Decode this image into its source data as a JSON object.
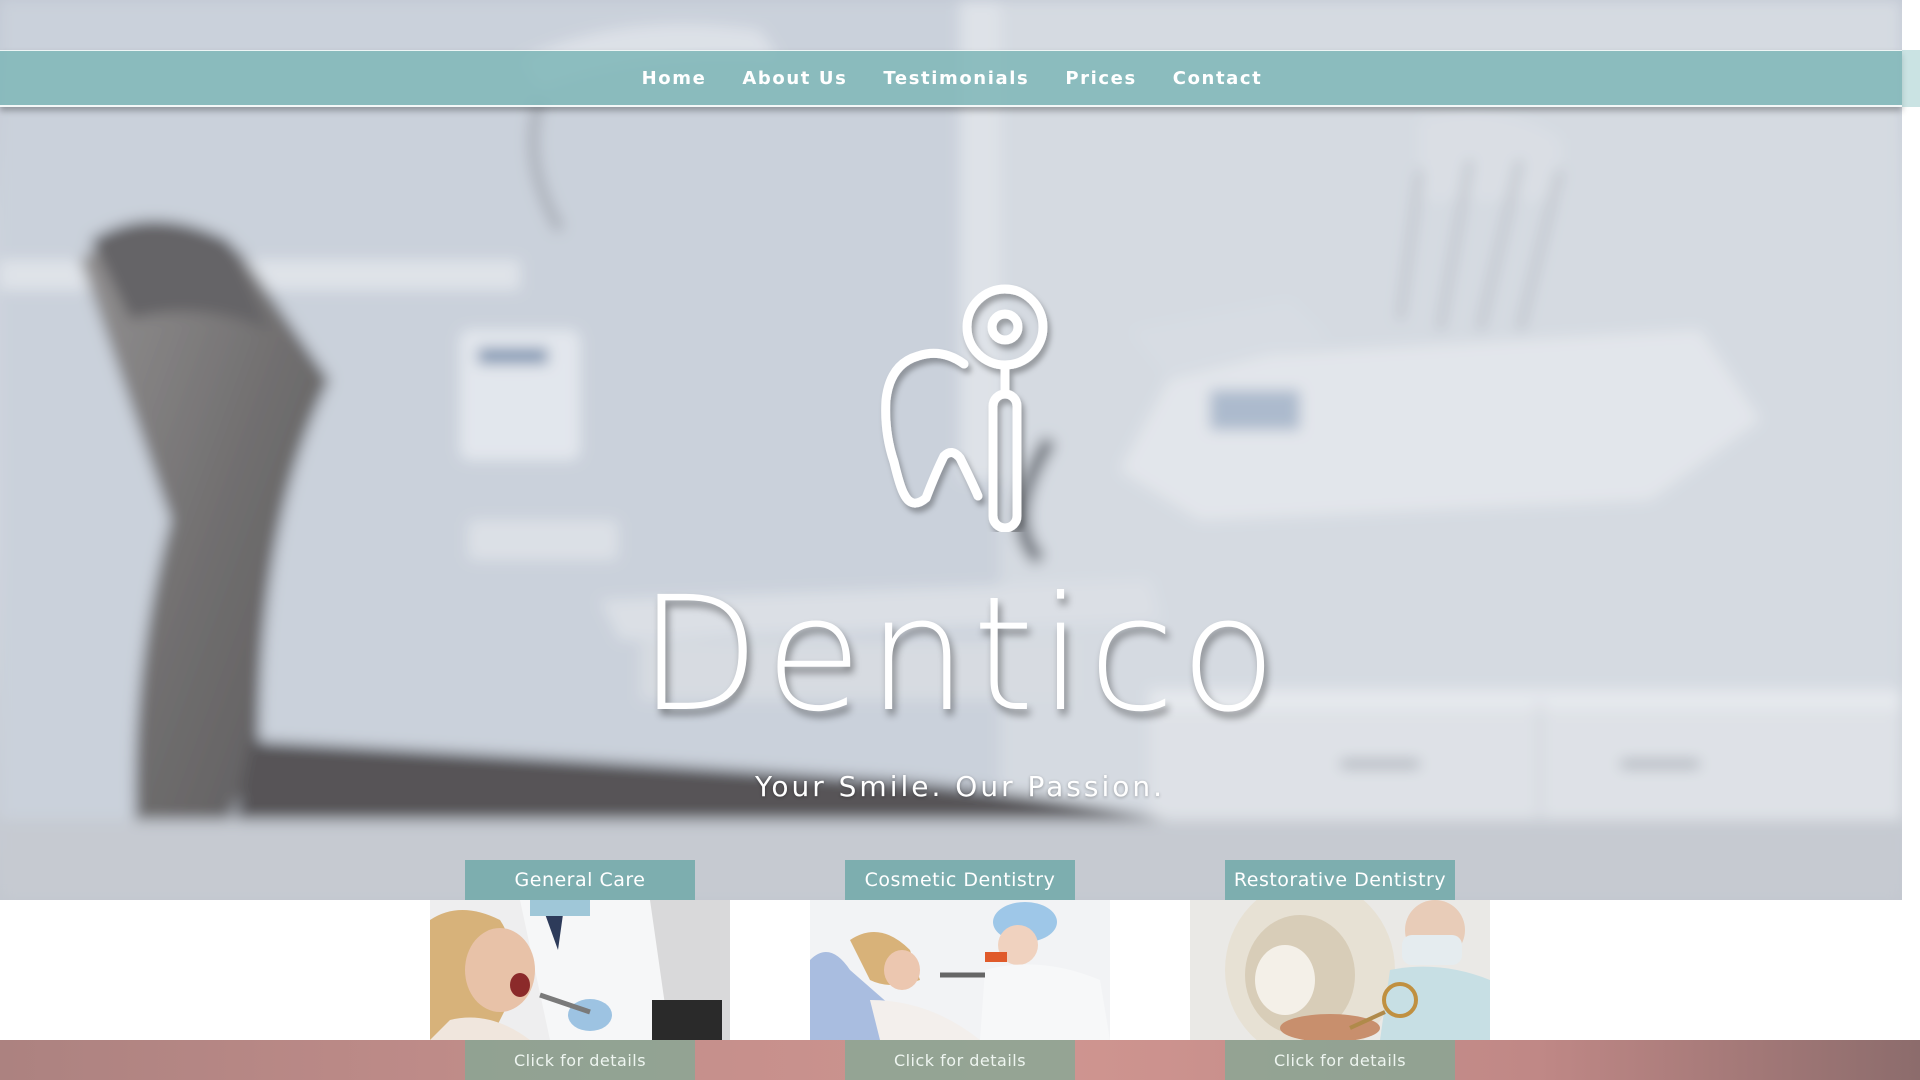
{
  "nav": {
    "items": [
      {
        "label": "Home"
      },
      {
        "label": "About Us"
      },
      {
        "label": "Testimonials"
      },
      {
        "label": "Prices"
      },
      {
        "label": "Contact"
      }
    ]
  },
  "hero": {
    "title": "Dentico",
    "tagline": "Your Smile. Our Passion.",
    "logo_icon": "tooth-mirror-icon",
    "background_image": "dental-clinic-chair-photo"
  },
  "services": [
    {
      "label": "General Care",
      "details_label": "Click for details",
      "image": "patient-open-mouth-photo"
    },
    {
      "label": "Cosmetic Dentistry",
      "details_label": "Click for details",
      "image": "patient-in-chair-with-dentist-photo"
    },
    {
      "label": "Restorative Dentistry",
      "details_label": "Click for details",
      "image": "dentist-holding-mirror-photo"
    }
  ],
  "colors": {
    "nav_bg": "#7fb7b8",
    "service_label_bg": "#73aaaa",
    "details_bg": "#82aa96",
    "text": "#ffffff",
    "bottom_band": "#c08c89"
  }
}
